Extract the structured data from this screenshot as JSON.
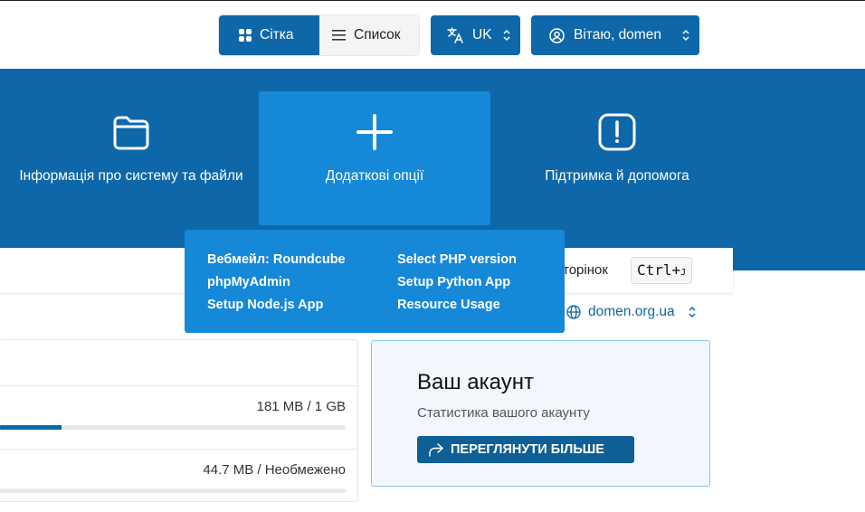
{
  "header": {
    "view_grid_label": "Сітка",
    "view_list_label": "Список",
    "language": "UK",
    "greeting": "Вітаю, domen"
  },
  "nav": {
    "tiles": [
      {
        "label": "Інформація про систему та файли",
        "icon": "folder-icon"
      },
      {
        "label": "Додаткові опції",
        "icon": "plus-icon"
      },
      {
        "label": "Підтримка й допомога",
        "icon": "alert-icon"
      }
    ]
  },
  "dropdown": {
    "items": [
      "Вебмейл: Roundcube",
      "phpMyAdmin",
      "Setup Node.js App",
      "Select PHP version",
      "Setup Python App",
      "Resource Usage"
    ]
  },
  "search": {
    "partial_text": "торінок",
    "shortcut": "Ctrl+",
    "shortcut_key": "J"
  },
  "domain": {
    "name": "domen.org.ua"
  },
  "usage": {
    "rows": [
      {
        "value": "181 MB / 1 GB",
        "fraction": 0.18
      },
      {
        "value": "44.7 MB / Необмежено",
        "fraction": 0.0
      }
    ]
  },
  "account": {
    "title": "Ваш акаунт",
    "subtitle": "Статистика вашого акаунту",
    "button_label": "ПЕРЕГЛЯНУТИ БІЛЬШЕ"
  },
  "colors": {
    "brand": "#0e67a8",
    "tile_active": "#1688d8"
  }
}
